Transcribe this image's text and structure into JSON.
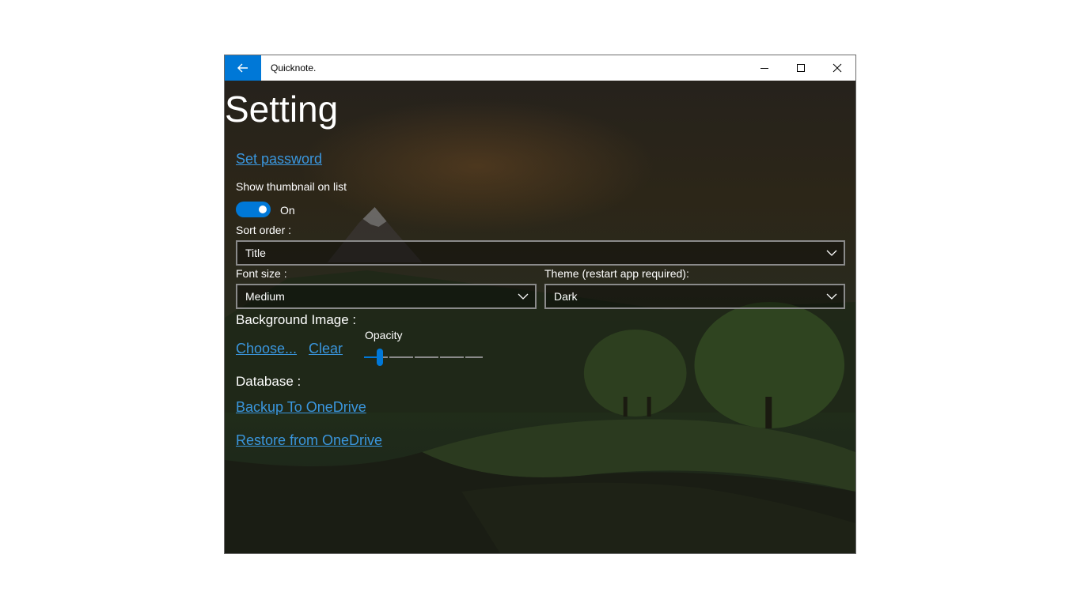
{
  "window": {
    "app_title": "Quicknote.",
    "back_icon": "arrow-left-icon",
    "accent_color": "#0078d7"
  },
  "page": {
    "title": "Setting"
  },
  "settings": {
    "set_password_link": "Set password",
    "show_thumbnail_label": "Show thumbnail on list",
    "show_thumbnail_toggle_state": "On",
    "sort_order_label": "Sort order :",
    "sort_order_value": "Title",
    "font_size_label": "Font size :",
    "font_size_value": "Medium",
    "theme_label": "Theme (restart app required):",
    "theme_value": "Dark",
    "background_image_label": "Background Image :",
    "choose_link": "Choose...",
    "clear_link": "Clear",
    "opacity_label": "Opacity",
    "opacity_value_fraction": 0.13,
    "database_label": "Database :",
    "backup_link": "Backup To OneDrive",
    "restore_link": "Restore from OneDrive"
  }
}
